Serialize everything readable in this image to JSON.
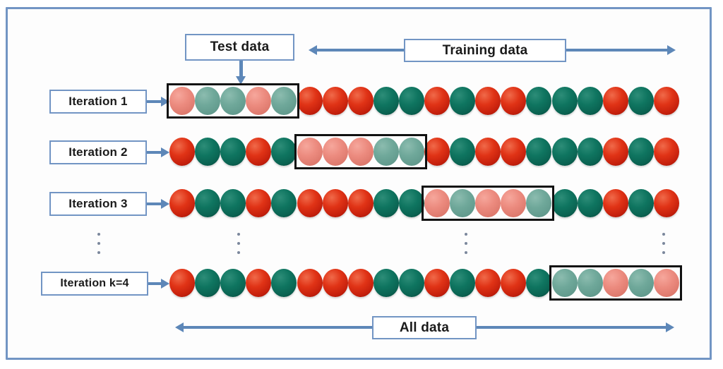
{
  "figure": {
    "title_labels": {
      "test_data": "Test data",
      "training_data": "Training data",
      "all_data": "All data"
    },
    "colors": {
      "frame_border": "#7295c4",
      "label_border": "#7295c4",
      "arrow": "#5d87b8",
      "ball_red": "#d92b13",
      "ball_teal": "#0b6b57",
      "ball_red_faded": "#e8837a",
      "ball_teal_faded": "#6fa99b",
      "selection_outline": "#111111",
      "dots": "#7b879c"
    },
    "icons": {
      "arrow_right": "arrow-right-icon",
      "arrow_down": "arrow-down-icon",
      "arrow_double": "double-headed-arrow-icon",
      "ellipsis": "vertical-ellipsis-icon"
    }
  },
  "rows": [
    {
      "label": "Iteration 1",
      "test_start_index": 0,
      "test_count": 5,
      "balls": [
        "red",
        "teal",
        "teal",
        "red",
        "teal",
        "red",
        "red",
        "red",
        "teal",
        "teal",
        "red",
        "teal",
        "red",
        "red",
        "teal",
        "teal",
        "teal",
        "red",
        "teal",
        "red"
      ]
    },
    {
      "label": "Iteration 2",
      "test_start_index": 5,
      "test_count": 5,
      "balls": [
        "red",
        "teal",
        "teal",
        "red",
        "teal",
        "red",
        "red",
        "red",
        "teal",
        "teal",
        "red",
        "teal",
        "red",
        "red",
        "teal",
        "teal",
        "teal",
        "red",
        "teal",
        "red"
      ]
    },
    {
      "label": "Iteration 3",
      "test_start_index": 10,
      "test_count": 5,
      "balls": [
        "red",
        "teal",
        "teal",
        "red",
        "teal",
        "red",
        "red",
        "red",
        "teal",
        "teal",
        "red",
        "teal",
        "red",
        "red",
        "teal",
        "teal",
        "teal",
        "red",
        "teal",
        "red"
      ]
    },
    {
      "label": "Iteration k=4",
      "test_start_index": 15,
      "test_count": 5,
      "balls": [
        "red",
        "teal",
        "teal",
        "red",
        "teal",
        "red",
        "red",
        "red",
        "teal",
        "teal",
        "red",
        "teal",
        "red",
        "red",
        "teal",
        "teal",
        "teal",
        "red",
        "teal",
        "red"
      ]
    }
  ],
  "ellipsis_columns": 4,
  "ball_count_per_row": 20
}
